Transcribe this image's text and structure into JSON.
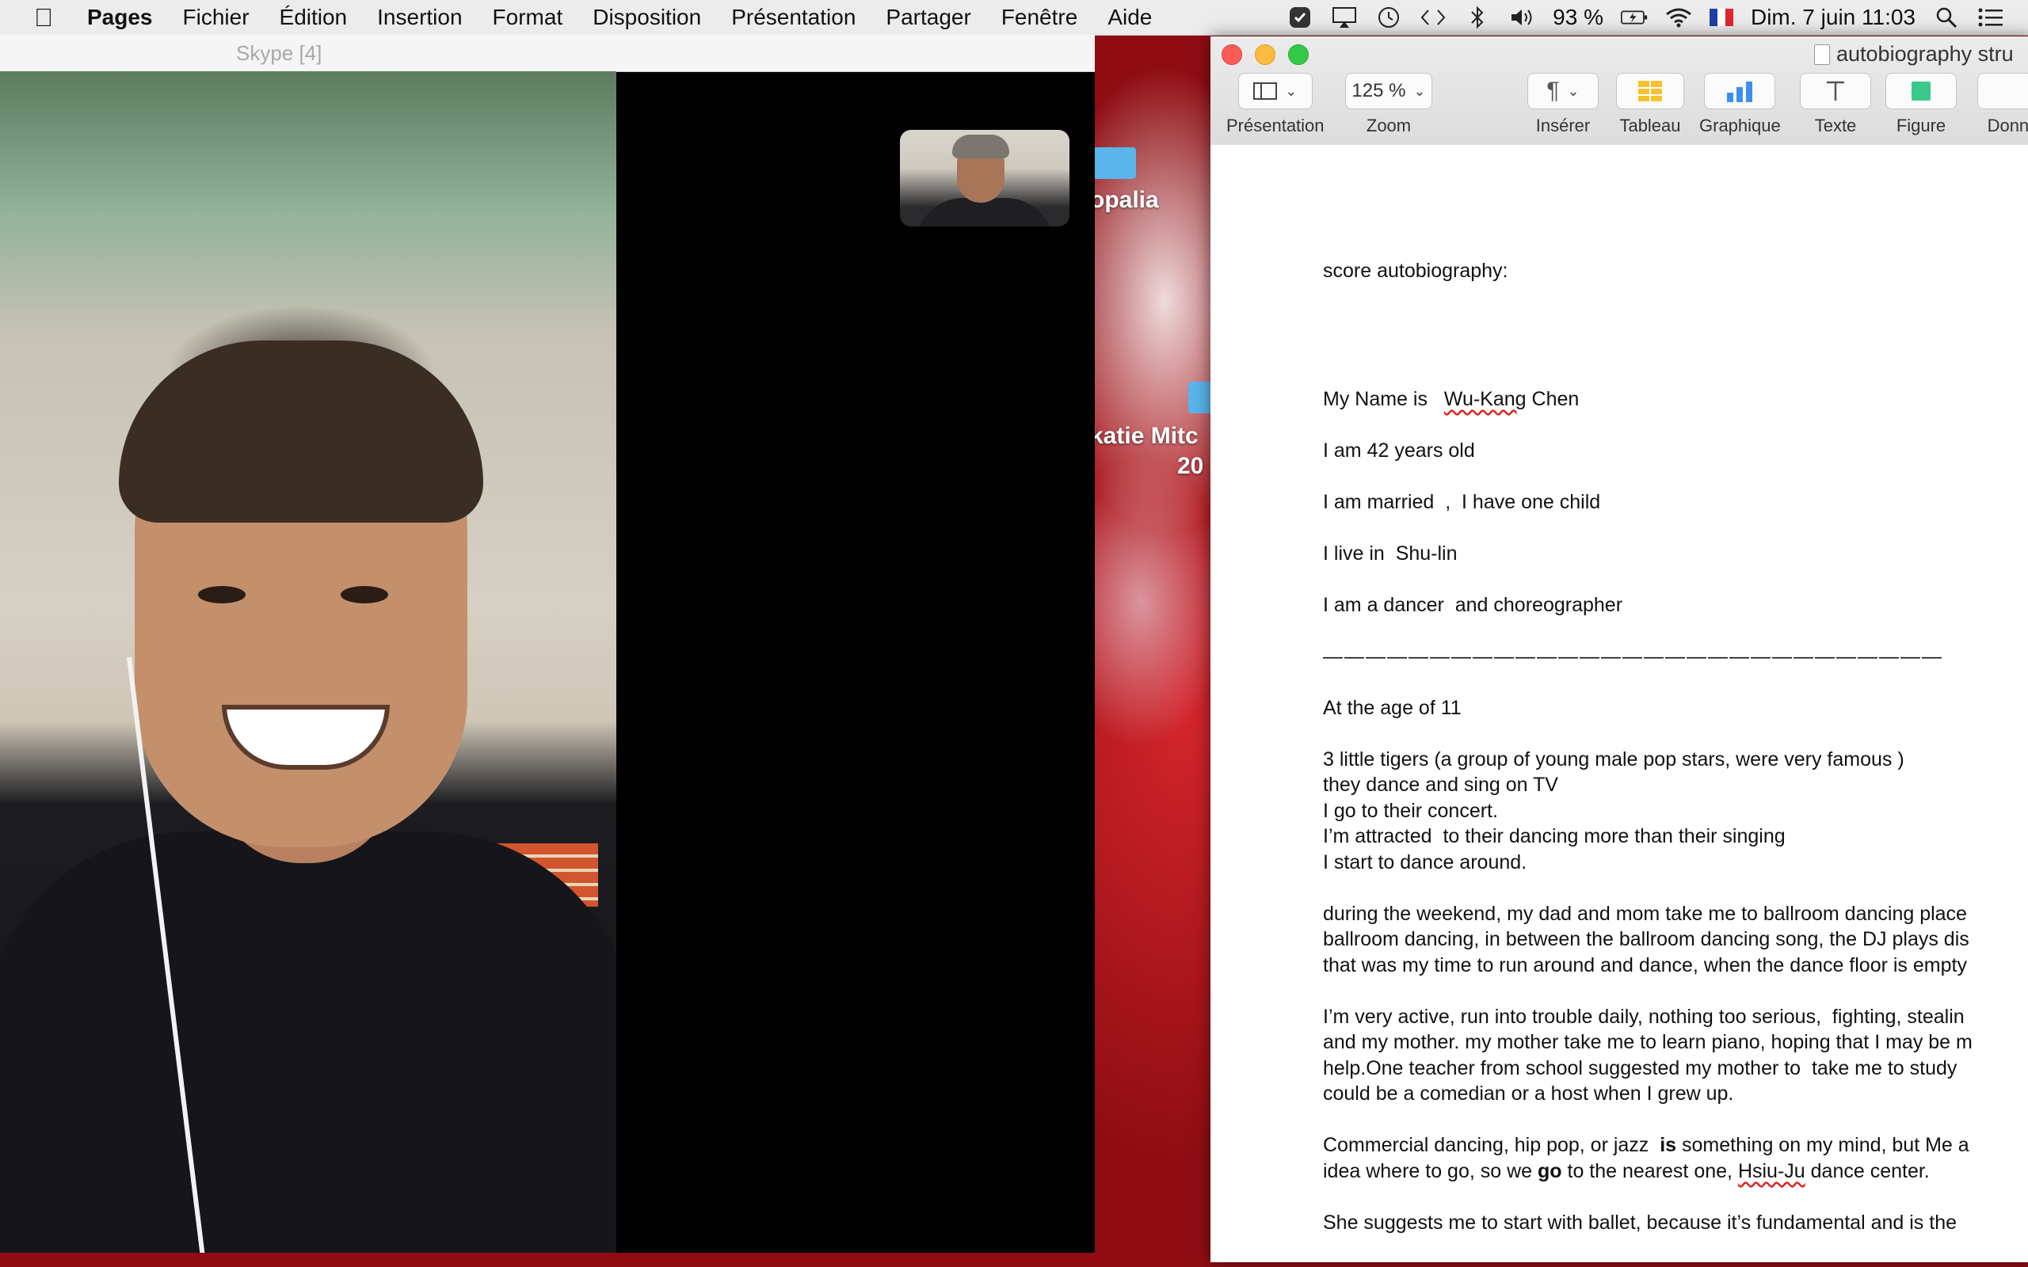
{
  "menubar": {
    "app": "Pages",
    "items": [
      "Fichier",
      "Édition",
      "Insertion",
      "Format",
      "Disposition",
      "Présentation",
      "Partager",
      "Fenêtre",
      "Aide"
    ],
    "battery": "93 %",
    "datetime": "Dim. 7 juin  11:03"
  },
  "skype": {
    "title": "Skype [4]"
  },
  "desktop": {
    "icon1_label": "opalia",
    "icon2_label_line1": "katie Mitc",
    "icon2_label_line2": "20"
  },
  "pages": {
    "title": "autobiography stru",
    "toolbar": {
      "presentation": "Présentation",
      "zoom_value": "125 %",
      "zoom": "Zoom",
      "inserer": "Insérer",
      "tableau": "Tableau",
      "graphique": "Graphique",
      "texte": "Texte",
      "figure": "Figure",
      "donnees": "Donné"
    },
    "doc": {
      "heading": "score autobiography:",
      "name_prefix": "My Name is   ",
      "name_first": "Wu-Kang",
      "name_last": " Chen",
      "age": "I am 42 years old",
      "married": "I am married  ,  I have one child",
      "live": "I live in  Shu-lin",
      "job": "I am a dancer  and choreographer",
      "rule": "—————————————————————————————",
      "age11": "At the age of 11",
      "p1": [
        "3 little tigers (a group of young male pop stars, were very famous )",
        "they dance and sing on TV",
        "I go to their concert.",
        "I’m attracted  to their dancing more than their singing",
        "I start to dance around."
      ],
      "p2": [
        "during the weekend, my dad and mom take me to ballroom dancing place",
        "ballroom dancing, in between the ballroom dancing song, the DJ plays dis",
        "that was my time to run around and dance, when the dance floor is empty"
      ],
      "p3": [
        "I’m very active, run into trouble daily, nothing too serious,  fighting, stealin",
        "and my mother. my mother take me to learn piano, hoping that I may be m",
        "help.One teacher from school suggested my mother to  take me to study",
        "could be a comedian or a host when I grew up."
      ],
      "p4a_pre": "Commercial dancing, hip pop, or jazz  ",
      "p4a_bold": "is",
      "p4a_post": " something on my mind, but Me a",
      "p4b_pre": "idea where to go, so we ",
      "p4b_bold": "go",
      "p4b_mid": " to the nearest one, ",
      "p4b_miss": "Hsiu-Ju",
      "p4b_post": " dance center.",
      "p5": "She suggests me to start with ballet, because it’s fundamental and is the"
    }
  }
}
